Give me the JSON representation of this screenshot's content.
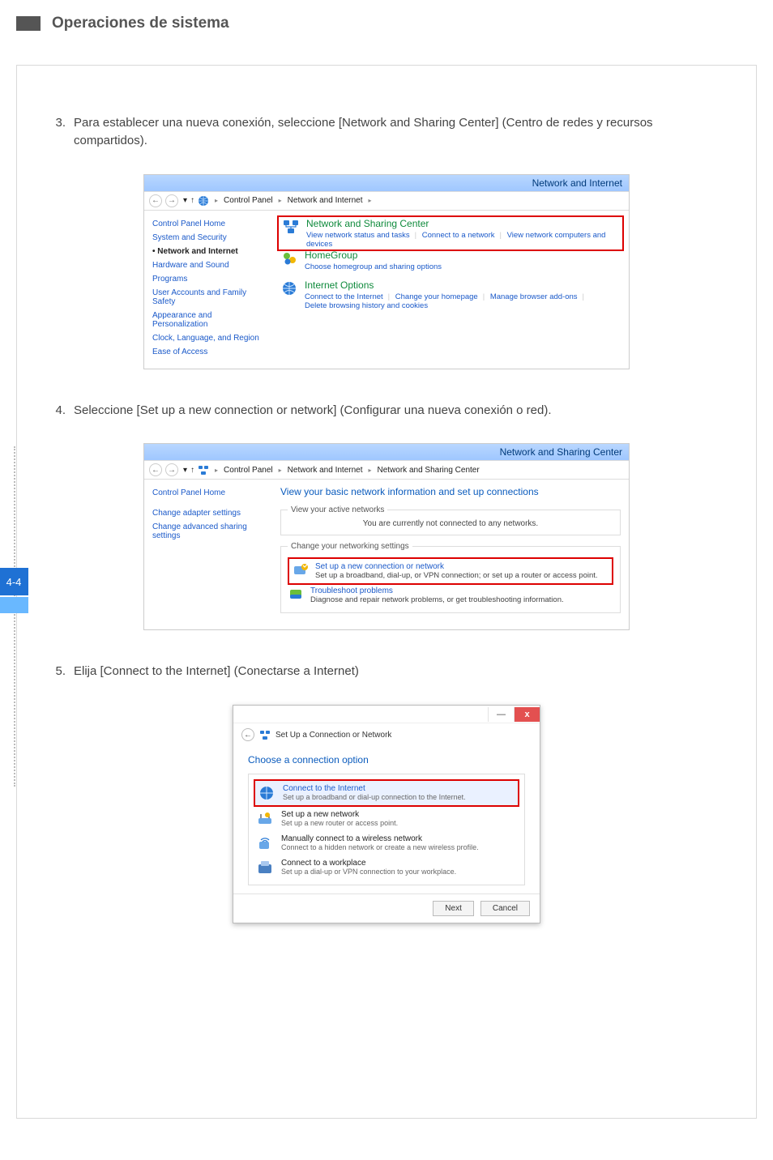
{
  "header": {
    "section_title": "Operaciones de sistema"
  },
  "page_tab": "4-4",
  "steps": {
    "s3": {
      "num": "3.",
      "text": "Para establecer una nueva conexión, seleccione [Network and Sharing Center] (Centro de redes y recursos compartidos)."
    },
    "s4": {
      "num": "4.",
      "text": "Seleccione [Set up a new connection or network] (Configurar una nueva conexión o red)."
    },
    "s5": {
      "num": "5.",
      "text": "Elija [Connect to the Internet] (Conectarse a Internet)"
    }
  },
  "shotA": {
    "window_title": "Network and Internet",
    "breadcrumb": {
      "root": "Control Panel",
      "leaf": "Network and Internet"
    },
    "side": {
      "home": "Control Panel Home",
      "sys": "System and Security",
      "net": "Network and Internet",
      "hw": "Hardware and Sound",
      "prog": "Programs",
      "uaf": "User Accounts and Family Safety",
      "appear": "Appearance and Personalization",
      "clock": "Clock, Language, and Region",
      "ease": "Ease of Access"
    },
    "cats": {
      "nsc": {
        "title": "Network and Sharing Center",
        "l1": "View network status and tasks",
        "l2": "Connect to a network",
        "l3": "View network computers and devices"
      },
      "hg": {
        "title": "HomeGroup",
        "l1": "Choose homegroup and sharing options"
      },
      "io": {
        "title": "Internet Options",
        "l1": "Connect to the Internet",
        "l2": "Change your homepage",
        "l3": "Manage browser add-ons",
        "l4": "Delete browsing history and cookies"
      }
    }
  },
  "shotB": {
    "window_title": "Network and Sharing Center",
    "breadcrumb": {
      "root": "Control Panel",
      "mid": "Network and Internet",
      "leaf": "Network and Sharing Center"
    },
    "side": {
      "home": "Control Panel Home",
      "adapter": "Change adapter settings",
      "adv": "Change advanced sharing settings"
    },
    "pane_title": "View your basic network information and set up connections",
    "group_active": {
      "legend": "View your active networks",
      "msg": "You are currently not connected to any networks."
    },
    "group_change": {
      "legend": "Change your networking settings",
      "opt1": {
        "title": "Set up a new connection or network",
        "desc": "Set up a broadband, dial-up, or VPN connection; or set up a router or access point."
      },
      "opt2": {
        "title": "Troubleshoot problems",
        "desc": "Diagnose and repair network problems, or get troubleshooting information."
      }
    }
  },
  "shotC": {
    "wizard_title": "Set Up a Connection or Network",
    "heading": "Choose a connection option",
    "opts": {
      "o1": {
        "title": "Connect to the Internet",
        "desc": "Set up a broadband or dial-up connection to the Internet."
      },
      "o2": {
        "title": "Set up a new network",
        "desc": "Set up a new router or access point."
      },
      "o3": {
        "title": "Manually connect to a wireless network",
        "desc": "Connect to a hidden network or create a new wireless profile."
      },
      "o4": {
        "title": "Connect to a workplace",
        "desc": "Set up a dial-up or VPN connection to your workplace."
      }
    },
    "buttons": {
      "next": "Next",
      "cancel": "Cancel"
    }
  }
}
